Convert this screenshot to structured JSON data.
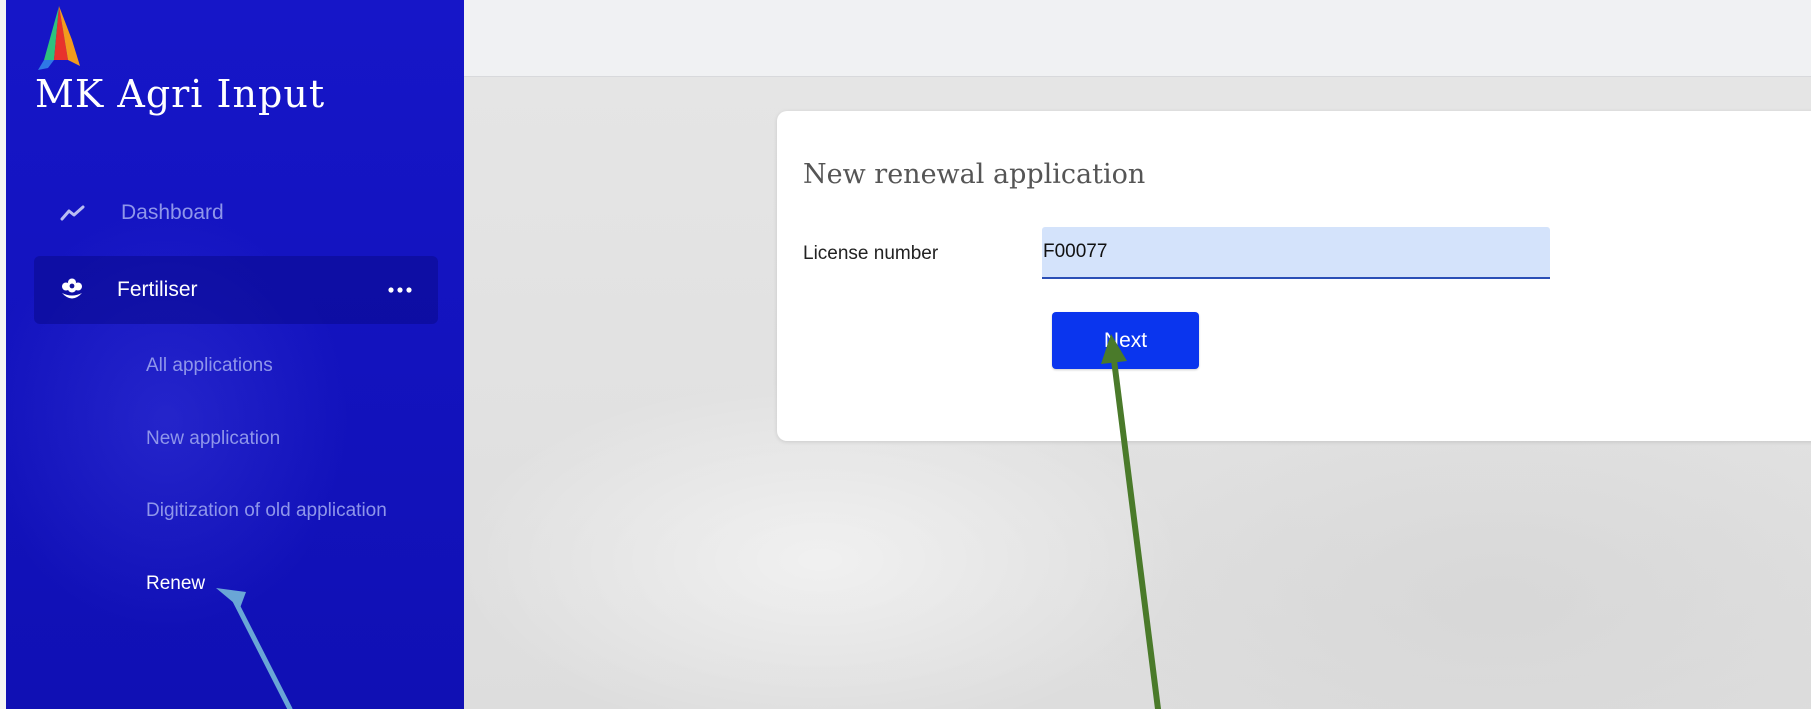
{
  "app": {
    "title": "MK Agri Input"
  },
  "sidebar": {
    "dashboard": {
      "label": "Dashboard",
      "icon": "trend-line-icon"
    },
    "fertiliser": {
      "label": "Fertiliser",
      "icon": "flower-icon",
      "more_icon": "more-horizontal-icon"
    },
    "subitems": [
      {
        "label": "All applications"
      },
      {
        "label": "New application"
      },
      {
        "label": "Digitization of old application"
      },
      {
        "label": "Renew",
        "active": true
      }
    ]
  },
  "form": {
    "title": "New renewal application",
    "license_label": "License number",
    "license_value": "F00077",
    "next_label": "Next"
  },
  "colors": {
    "sidebar": "#1313be",
    "primary_button": "#0a35ee",
    "input_bg": "#d4e3fb",
    "annotation_arrow_green": "#4a7a2a",
    "annotation_arrow_blue": "#6aa6d6"
  }
}
